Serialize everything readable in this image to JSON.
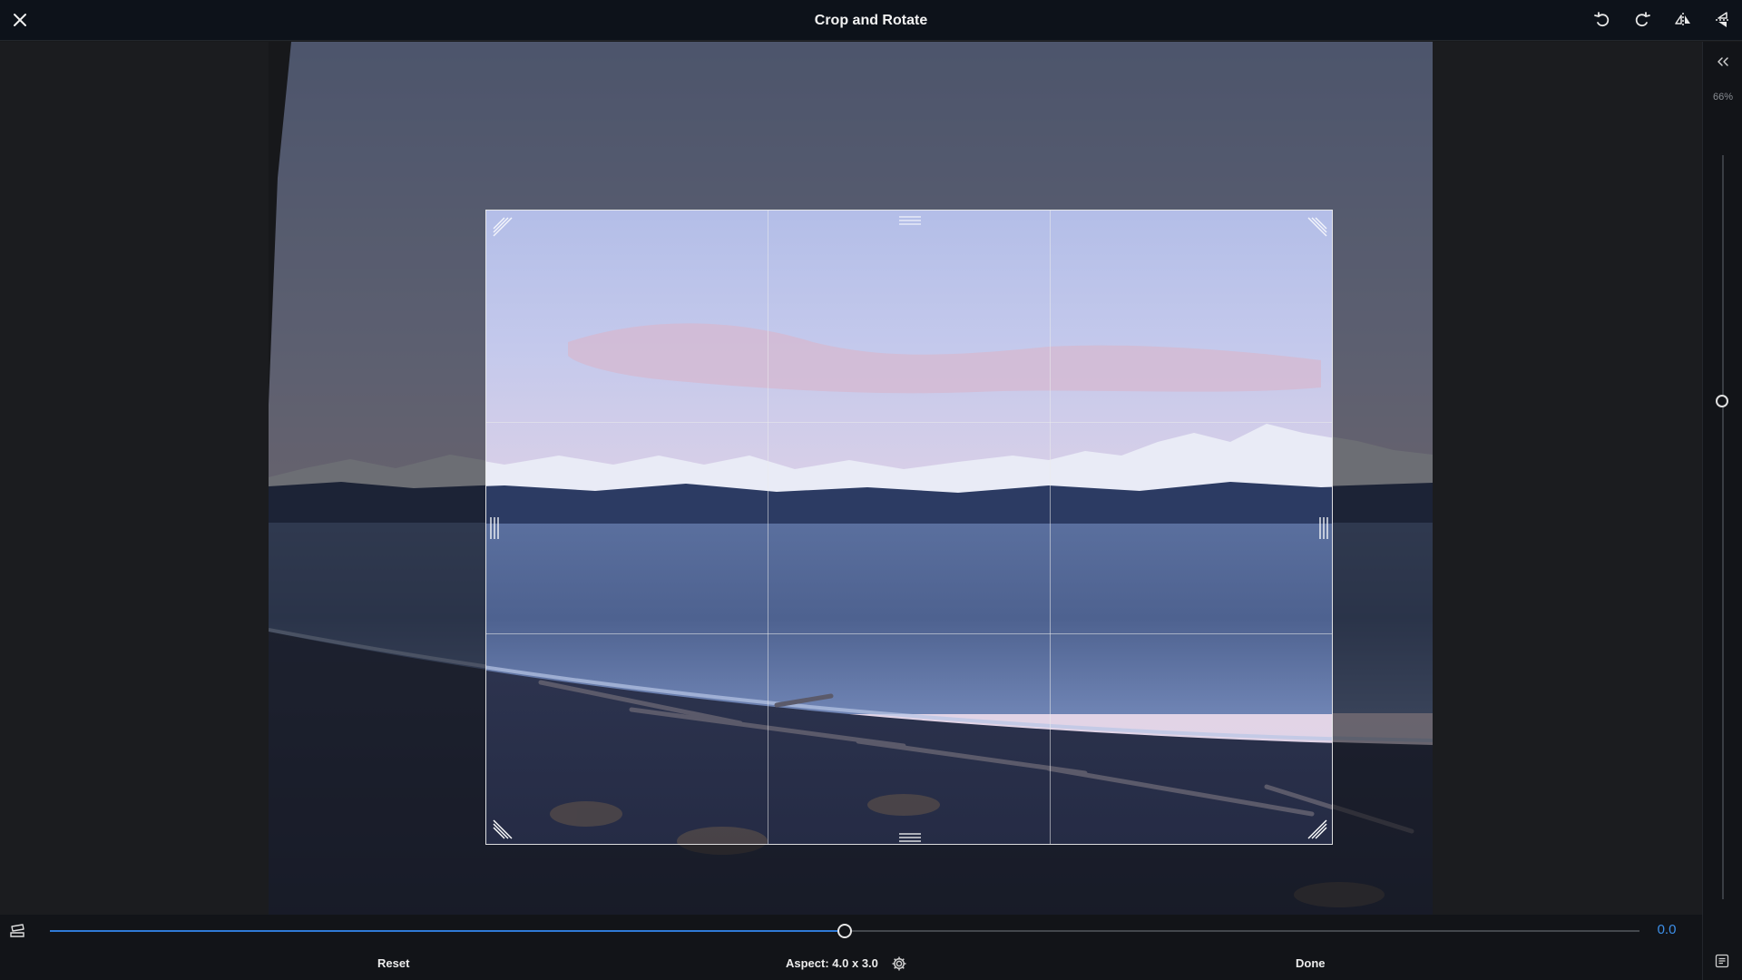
{
  "header": {
    "title": "Crop and Rotate",
    "icons": [
      "close-icon",
      "rotate-left-icon",
      "rotate-right-icon",
      "flip-horizontal-icon",
      "flip-vertical-icon"
    ]
  },
  "side_panel": {
    "collapse_icon": "chevrons-left-icon",
    "zoom_label": "66%",
    "zoom_level": 0.66
  },
  "straighten": {
    "value_label": "0.0",
    "value": 0.0,
    "range": [
      -45,
      45
    ]
  },
  "footer": {
    "reset_label": "Reset",
    "aspect_label": "Aspect: 4.0 x 3.0",
    "done_label": "Done",
    "icons": [
      "auto-straighten-icon",
      "aspect-settings-gear-icon",
      "info-panel-icon"
    ]
  },
  "crop": {
    "aspect_ratio": "4.0 x 3.0",
    "grid": "rule-of-thirds"
  },
  "colors": {
    "accent": "#2f7ad6",
    "accent_text": "#3d8fe8",
    "toolbar_bg": "#0d121a",
    "panel_bg": "#121418"
  }
}
